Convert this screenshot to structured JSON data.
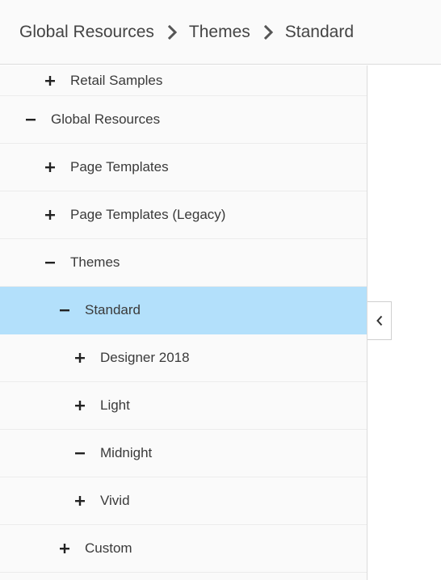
{
  "breadcrumb": {
    "items": [
      "Global Resources",
      "Themes",
      "Standard"
    ],
    "separator_icon": "chevron-right-icon"
  },
  "tree": {
    "items": [
      {
        "label": "Retail Samples",
        "level": 1,
        "state": "collapsed"
      },
      {
        "label": "Global Resources",
        "level": 0,
        "state": "expanded"
      },
      {
        "label": "Page Templates",
        "level": 1,
        "state": "collapsed"
      },
      {
        "label": "Page Templates (Legacy)",
        "level": 1,
        "state": "collapsed"
      },
      {
        "label": "Themes",
        "level": 1,
        "state": "expanded"
      },
      {
        "label": "Standard",
        "level": 2,
        "state": "expanded",
        "selected": true
      },
      {
        "label": "Designer 2018",
        "level": 3,
        "state": "collapsed"
      },
      {
        "label": "Light",
        "level": 3,
        "state": "collapsed"
      },
      {
        "label": "Midnight",
        "level": 3,
        "state": "expanded"
      },
      {
        "label": "Vivid",
        "level": 3,
        "state": "collapsed"
      },
      {
        "label": "Custom",
        "level": 2,
        "state": "collapsed"
      }
    ]
  },
  "collapse_button": {
    "icon": "chevron-left-icon"
  },
  "colors": {
    "selected_row": "#b3e0fb",
    "panel_background": "#fafafa",
    "text": "#3a3a3a"
  }
}
